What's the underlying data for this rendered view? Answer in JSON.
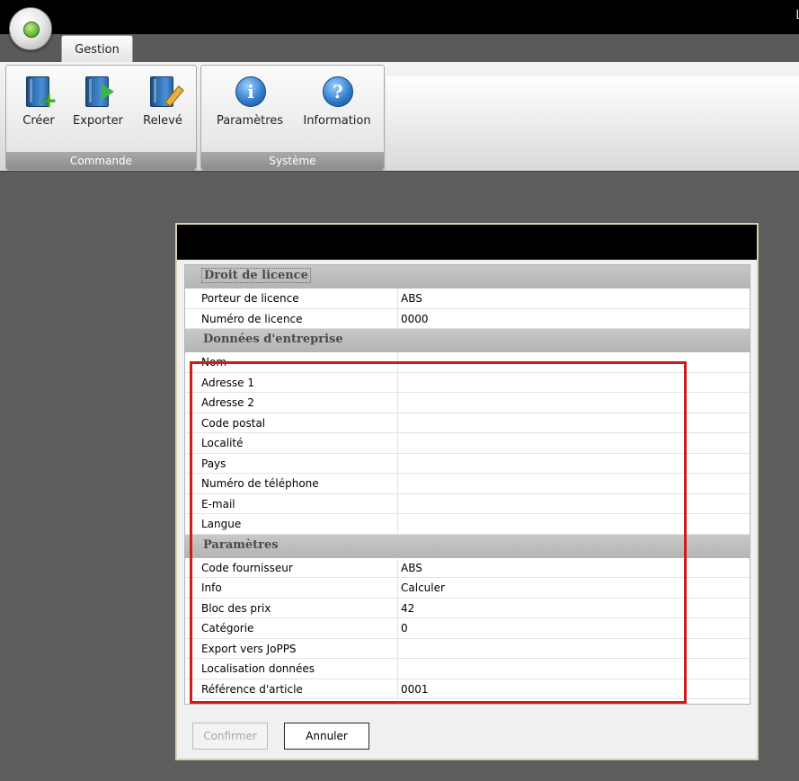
{
  "window": {
    "title_fragment": "L"
  },
  "ribbon": {
    "tab": "Gestion",
    "groups": [
      {
        "label": "Commande",
        "buttons": [
          {
            "label": "Créer",
            "icon": "book-add-icon"
          },
          {
            "label": "Exporter",
            "icon": "book-export-icon"
          },
          {
            "label": "Relevé",
            "icon": "book-edit-icon"
          }
        ]
      },
      {
        "label": "Système",
        "buttons": [
          {
            "label": "Paramètres",
            "icon": "info-icon"
          },
          {
            "label": "Information",
            "icon": "help-icon"
          }
        ]
      }
    ]
  },
  "dialog": {
    "sections": [
      {
        "title": "Droit de licence",
        "rows": [
          {
            "label": "Porteur de licence",
            "value": "ABS"
          },
          {
            "label": "Numéro de licence",
            "value": "0000"
          }
        ]
      },
      {
        "title": "Données d'entreprise",
        "rows": [
          {
            "label": "Nom",
            "value": ""
          },
          {
            "label": "Adresse 1",
            "value": ""
          },
          {
            "label": "Adresse 2",
            "value": ""
          },
          {
            "label": "Code postal",
            "value": ""
          },
          {
            "label": "Localité",
            "value": ""
          },
          {
            "label": "Pays",
            "value": ""
          },
          {
            "label": "Numéro de téléphone",
            "value": ""
          },
          {
            "label": "E-mail",
            "value": ""
          },
          {
            "label": "Langue",
            "value": ""
          }
        ]
      },
      {
        "title": "Paramètres",
        "rows": [
          {
            "label": "Code fournisseur",
            "value": "ABS"
          },
          {
            "label": "Info",
            "value": "Calculer"
          },
          {
            "label": "Bloc des prix",
            "value": "42"
          },
          {
            "label": "Catégorie",
            "value": "0"
          },
          {
            "label": "Export vers JoPPS",
            "value": ""
          },
          {
            "label": "Localisation données",
            "value": ""
          },
          {
            "label": "Référence d'article",
            "value": "0001"
          }
        ]
      }
    ],
    "confirm_label": "Confirmer",
    "cancel_label": "Annuler"
  },
  "colors": {
    "highlight": "#d11a1a",
    "dialog_border": "#d8cfae"
  }
}
